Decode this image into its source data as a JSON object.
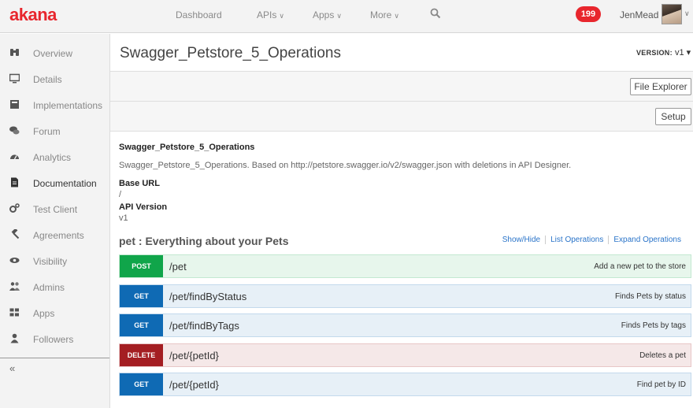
{
  "app": {
    "logo": "akana"
  },
  "topnav": {
    "dashboard": "Dashboard",
    "apis": "APIs",
    "apps": "Apps",
    "more": "More",
    "search_icon": "search-icon",
    "notifications_count": "199",
    "user_name": "JenMead"
  },
  "sidebar": {
    "items": [
      {
        "label": "Overview",
        "icon": "binoculars-icon"
      },
      {
        "label": "Details",
        "icon": "monitor-icon"
      },
      {
        "label": "Implementations",
        "icon": "book-icon"
      },
      {
        "label": "Forum",
        "icon": "comments-icon"
      },
      {
        "label": "Analytics",
        "icon": "dashboard-icon"
      },
      {
        "label": "Documentation",
        "icon": "document-icon",
        "active": true
      },
      {
        "label": "Test Client",
        "icon": "cogs-icon"
      },
      {
        "label": "Agreements",
        "icon": "gavel-icon"
      },
      {
        "label": "Visibility",
        "icon": "eye-icon"
      },
      {
        "label": "Admins",
        "icon": "users-icon"
      },
      {
        "label": "Apps",
        "icon": "grid-icon"
      },
      {
        "label": "Followers",
        "icon": "user-icon"
      }
    ],
    "collapse": "«"
  },
  "page": {
    "title": "Swagger_Petstore_5_Operations",
    "version_label": "VERSION:",
    "version_value": "v1",
    "file_explorer": "File Explorer",
    "setup": "Setup"
  },
  "doc": {
    "api_name": "Swagger_Petstore_5_Operations",
    "description": "Swagger_Petstore_5_Operations. Based on http://petstore.swagger.io/v2/swagger.json with deletions in API Designer.",
    "base_url_label": "Base URL",
    "base_url_value": "/",
    "api_version_label": "API Version",
    "api_version_value": "v1",
    "section_title": "pet : Everything about your Pets",
    "links": {
      "show_hide": "Show/Hide",
      "list_ops": "List Operations",
      "expand_ops": "Expand Operations"
    },
    "operations": [
      {
        "method": "POST",
        "path": "/pet",
        "summary": "Add a new pet to the store"
      },
      {
        "method": "GET",
        "path": "/pet/findByStatus",
        "summary": "Finds Pets by status"
      },
      {
        "method": "GET",
        "path": "/pet/findByTags",
        "summary": "Finds Pets by tags"
      },
      {
        "method": "DELETE",
        "path": "/pet/{petId}",
        "summary": "Deletes a pet"
      },
      {
        "method": "GET",
        "path": "/pet/{petId}",
        "summary": "Find pet by ID"
      }
    ]
  },
  "colors": {
    "brand": "#e8262d",
    "post": "#10a54a",
    "get": "#0f6ab4",
    "delete": "#a41e22",
    "link": "#2a74c9"
  }
}
